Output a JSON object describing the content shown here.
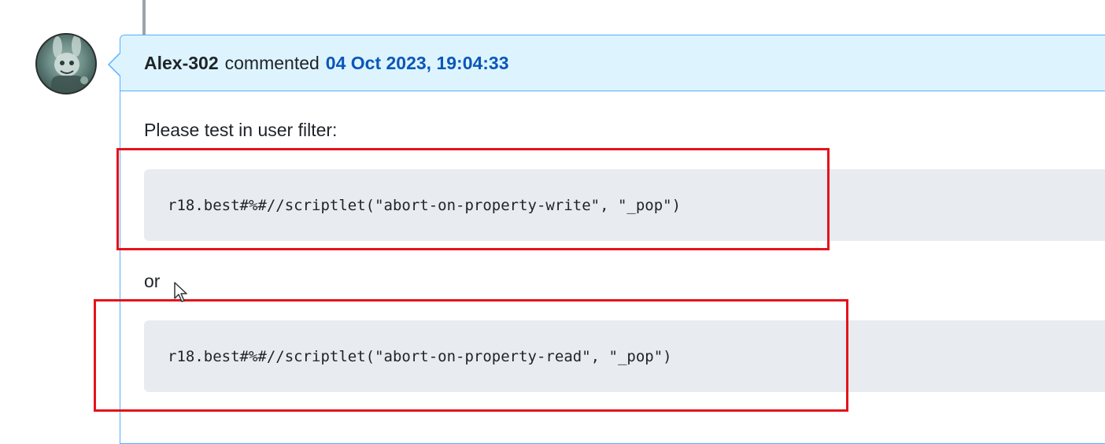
{
  "comment": {
    "author": "Alex-302",
    "action": "commented",
    "timestamp": "04 Oct 2023, 19:04:33"
  },
  "body": {
    "intro_text": "Please test in user filter:",
    "code_1": "r18.best#%#//scriptlet(\"abort-on-property-write\", \"_pop\")",
    "separator_text": "or",
    "code_2": "r18.best#%#//scriptlet(\"abort-on-property-read\", \"_pop\")"
  },
  "colors": {
    "header_bg": "#ddf4ff",
    "header_border": "#54aeff",
    "link": "#0b57b8",
    "code_bg": "#e8ecf0",
    "highlight": "#e3141b"
  },
  "icons": {
    "avatar": "user-avatar",
    "cursor": "mouse-pointer-icon"
  }
}
